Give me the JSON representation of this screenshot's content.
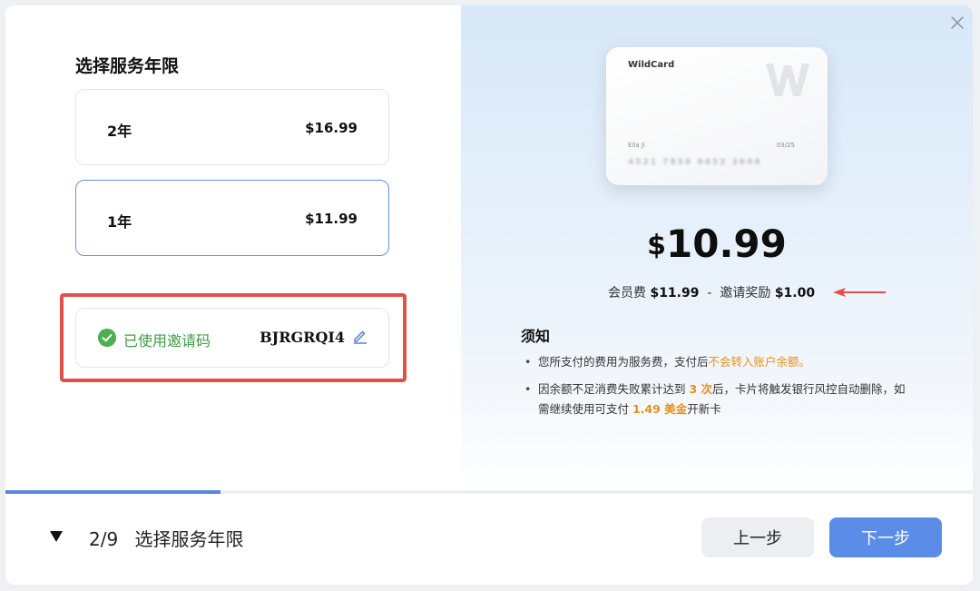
{
  "left": {
    "title": "选择服务年限",
    "plans": [
      {
        "name": "2年",
        "price": "$16.99",
        "selected": false
      },
      {
        "name": "1年",
        "price": "$11.99",
        "selected": true
      }
    ],
    "invite": {
      "status": "已使用邀请码",
      "code": "BJRGRQI4"
    }
  },
  "card": {
    "brand": "WildCard",
    "holder": "Ella Ji",
    "expiry": "03/25",
    "number_masked": "4521 7856 9452 3698"
  },
  "summary": {
    "currency": "$",
    "amount": "10.99",
    "fee_label": "会员费",
    "fee_value": "$11.99",
    "separator": "-",
    "reward_label": "邀请奖励",
    "reward_value": "$1.00"
  },
  "notice": {
    "title": "须知",
    "item1_text": "您所支付的费用为服务费，支付后",
    "item1_highlight": "不会转入账户余额。",
    "item2_a": "因余额不足消费失败累计达到 ",
    "item2_count": "3 次",
    "item2_b": "后，卡片将触发银行风控自动删除，如需继续使用可支付 ",
    "item2_amount": "1.49 美金",
    "item2_c": "开新卡"
  },
  "footer": {
    "step": "2/9",
    "step_title": "选择服务年限",
    "prev_label": "上一步",
    "next_label": "下一步",
    "progress": 0.222
  },
  "colors": {
    "accent": "#5b8de8",
    "highlight_border": "#e25149",
    "success": "#4caf50",
    "orange": "#e8901a"
  }
}
